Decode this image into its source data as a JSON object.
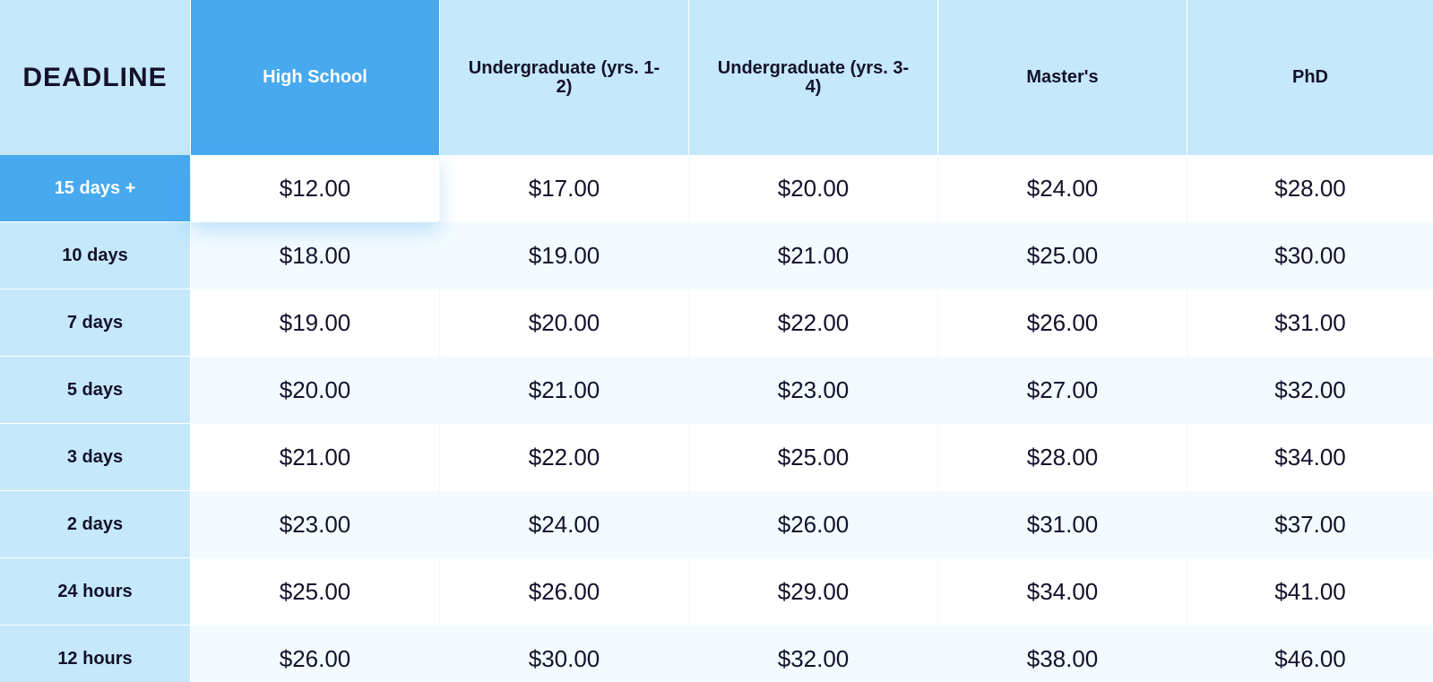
{
  "table": {
    "corner_label": "DEADLINE",
    "columns": [
      "High School",
      "Undergraduate (yrs. 1-2)",
      "Undergraduate (yrs. 3-4)",
      "Master's",
      "PhD"
    ],
    "active_column": "High School",
    "active_row": "15 days +",
    "rows": [
      {
        "deadline": "15 days +",
        "prices": [
          "$12.00",
          "$17.00",
          "$20.00",
          "$24.00",
          "$28.00"
        ]
      },
      {
        "deadline": "10 days",
        "prices": [
          "$18.00",
          "$19.00",
          "$21.00",
          "$25.00",
          "$30.00"
        ]
      },
      {
        "deadline": "7 days",
        "prices": [
          "$19.00",
          "$20.00",
          "$22.00",
          "$26.00",
          "$31.00"
        ]
      },
      {
        "deadline": "5 days",
        "prices": [
          "$20.00",
          "$21.00",
          "$23.00",
          "$27.00",
          "$32.00"
        ]
      },
      {
        "deadline": "3 days",
        "prices": [
          "$21.00",
          "$22.00",
          "$25.00",
          "$28.00",
          "$34.00"
        ]
      },
      {
        "deadline": "2 days",
        "prices": [
          "$23.00",
          "$24.00",
          "$26.00",
          "$31.00",
          "$37.00"
        ]
      },
      {
        "deadline": "24 hours",
        "prices": [
          "$25.00",
          "$26.00",
          "$29.00",
          "$34.00",
          "$41.00"
        ]
      },
      {
        "deadline": "12 hours",
        "prices": [
          "$26.00",
          "$30.00",
          "$32.00",
          "$38.00",
          "$46.00"
        ]
      }
    ]
  },
  "colors": {
    "header_bg": "#c5e8fb",
    "active_bg": "#47a9ee",
    "stripe_bg": "#f3fbff",
    "text": "#14112b"
  }
}
